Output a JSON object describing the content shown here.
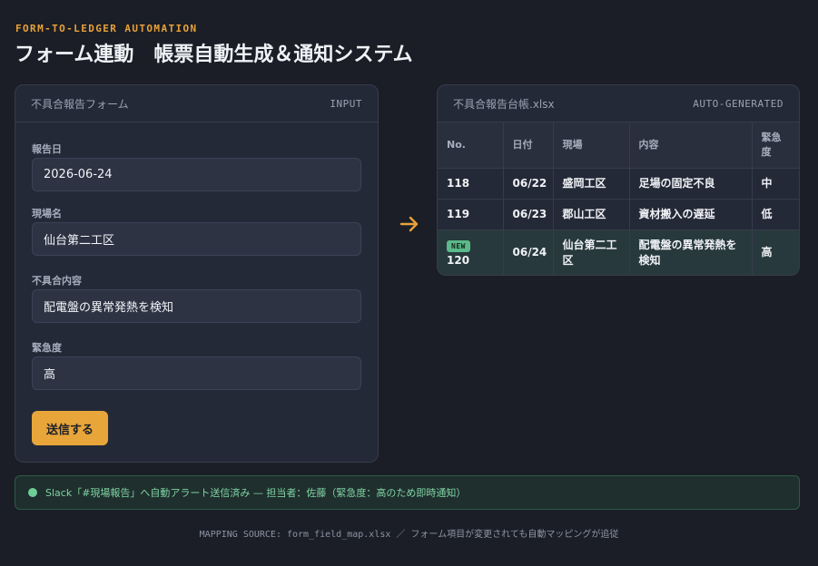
{
  "header": {
    "eyebrow": "FORM-TO-LEDGER AUTOMATION",
    "title": "フォーム連動　帳票自動生成＆通知システム"
  },
  "form": {
    "name": "不具合報告フォーム",
    "tag": "INPUT",
    "fields": [
      {
        "label": "報告日",
        "value": "2026-06-24"
      },
      {
        "label": "現場名",
        "value": "仙台第二工区"
      },
      {
        "label": "不具合内容",
        "value": "配電盤の異常発熱を検知"
      },
      {
        "label": "緊急度",
        "value": "高"
      }
    ],
    "submit_label": "送信する"
  },
  "ledger": {
    "name": "不具合報告台帳.xlsx",
    "tag": "AUTO-GENERATED",
    "columns": [
      "No.",
      "日付",
      "現場",
      "内容",
      "緊急度"
    ],
    "rows": [
      {
        "no": "118",
        "date": "06/22",
        "site": "盛岡工区",
        "content": "足場の固定不良",
        "urgency": "中"
      },
      {
        "no": "119",
        "date": "06/23",
        "site": "郡山工区",
        "content": "資材搬入の遅延",
        "urgency": "低"
      },
      {
        "no": "120",
        "date": "06/24",
        "site": "仙台第二工区",
        "content": "配電盤の異常発熱を検知",
        "urgency": "高",
        "badge": "NEW"
      }
    ]
  },
  "notice": {
    "text": "Slack「#現場報告」へ自動アラート送信済み — 担当者：佐藤（緊急度：高のため即時通知）"
  },
  "footer": {
    "text": "MAPPING SOURCE: form_field_map.xlsx ／ フォーム項目が変更されても自動マッピングが追従"
  },
  "colors": {
    "background": "#1b1e27",
    "accent": "#e8a23a",
    "success": "#6dcf97"
  }
}
